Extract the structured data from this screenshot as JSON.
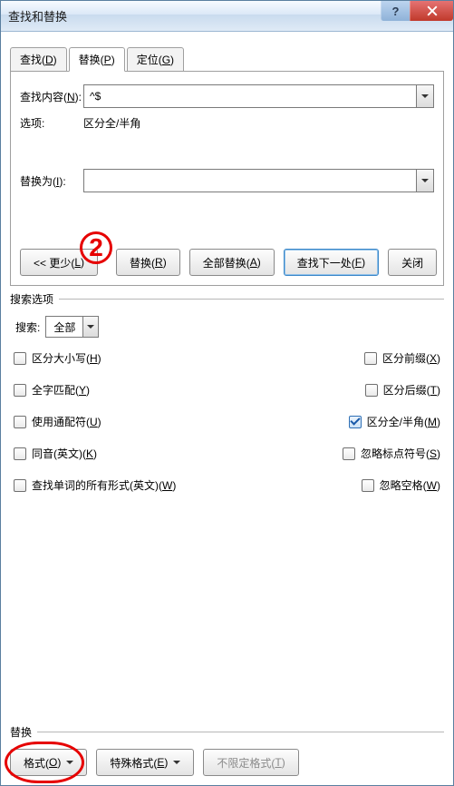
{
  "window": {
    "title": "查找和替换"
  },
  "titlebar": {
    "help": "?",
    "close": "X"
  },
  "tabs": {
    "find": {
      "label": "查找(",
      "key": "D",
      "suffix": ")"
    },
    "replace": {
      "label": "替换(",
      "key": "P",
      "suffix": ")"
    },
    "goto": {
      "label": "定位(",
      "key": "G",
      "suffix": ")"
    }
  },
  "find": {
    "label_pre": "查找内容(",
    "label_key": "N",
    "label_suf": "):",
    "value": "^$",
    "options_label": "选项:",
    "options_value": "区分全/半角"
  },
  "replace": {
    "label_pre": "替换为(",
    "label_key": "I",
    "label_suf": "):",
    "value": ""
  },
  "annotation": {
    "circled": "2"
  },
  "buttons": {
    "less_pre": "<< 更少(",
    "less_key": "L",
    "less_suf": ")",
    "replace_pre": "替换(",
    "replace_key": "R",
    "replace_suf": ")",
    "replace_all_pre": "全部替换(",
    "replace_all_key": "A",
    "replace_all_suf": ")",
    "find_next_pre": "查找下一处(",
    "find_next_key": "F",
    "find_next_suf": ")",
    "close": "关闭"
  },
  "search_options": {
    "legend": "搜索选项",
    "direction_label": "搜索:",
    "direction_value": "全部"
  },
  "checks": {
    "match_case": {
      "pre": "区分大小写(",
      "key": "H",
      "suf": ")",
      "checked": false
    },
    "match_prefix": {
      "pre": "区分前缀(",
      "key": "X",
      "suf": ")",
      "checked": false
    },
    "whole_word": {
      "pre": "全字匹配(",
      "key": "Y",
      "suf": ")",
      "checked": false
    },
    "match_suffix": {
      "pre": "区分后缀(",
      "key": "T",
      "suf": ")",
      "checked": false
    },
    "wildcards": {
      "pre": "使用通配符(",
      "key": "U",
      "suf": ")",
      "checked": false
    },
    "full_half": {
      "pre": "区分全/半角(",
      "key": "M",
      "suf": ")",
      "checked": true
    },
    "sounds_like": {
      "pre": "同音(英文)(",
      "key": "K",
      "suf": ")",
      "checked": false
    },
    "ignore_punct": {
      "pre": "忽略标点符号(",
      "key": "S",
      "suf": ")",
      "checked": false
    },
    "all_word_forms": {
      "pre": "查找单词的所有形式(英文)(",
      "key": "W",
      "suf": ")",
      "checked": false
    },
    "ignore_space": {
      "pre": "忽略空格(",
      "key": "W",
      "suf": ")",
      "checked": false
    }
  },
  "replace_group": {
    "legend": "替换",
    "format_pre": "格式(",
    "format_key": "O",
    "format_suf": ")",
    "special_pre": "特殊格式(",
    "special_key": "E",
    "special_suf": ")",
    "noformat_pre": "不限定格式(",
    "noformat_key": "T",
    "noformat_suf": ")"
  }
}
